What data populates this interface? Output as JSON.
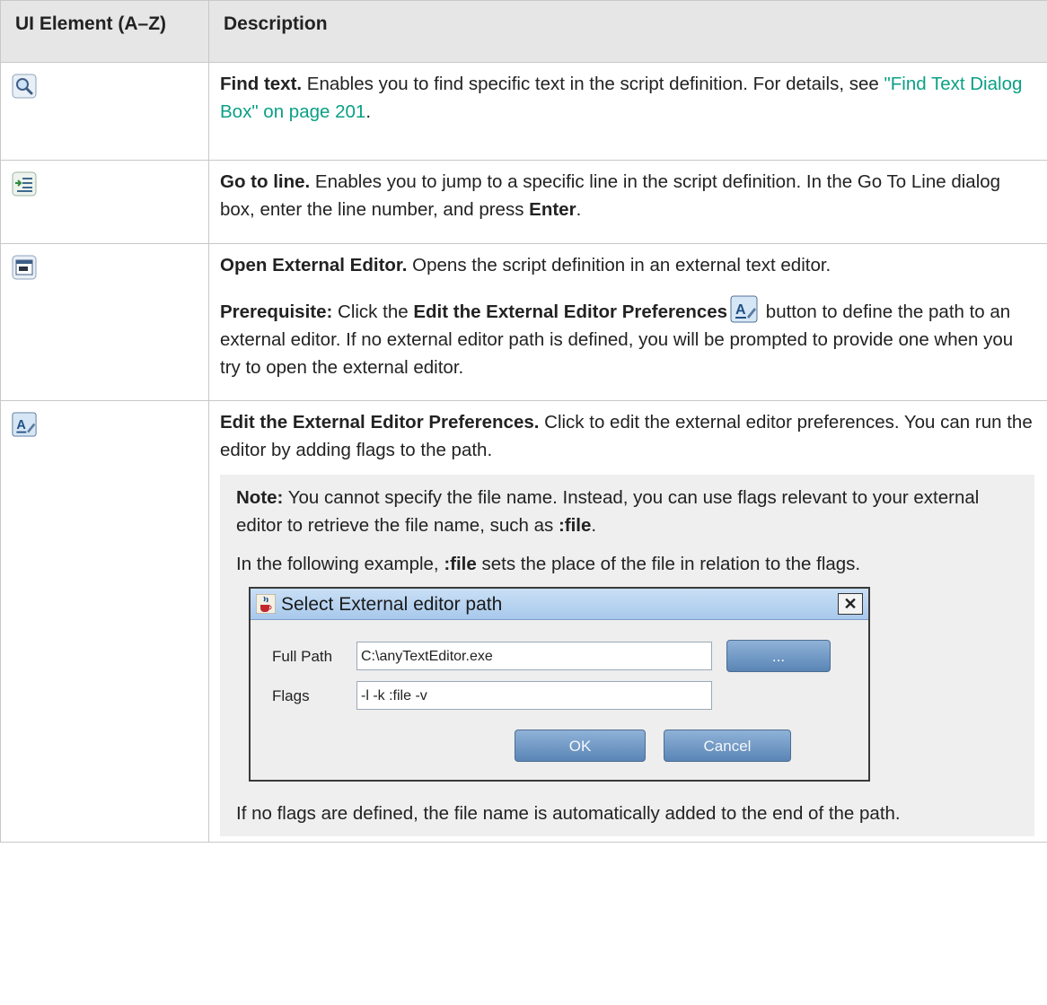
{
  "table": {
    "headers": [
      "UI Element (A–Z)",
      "Description"
    ]
  },
  "rows": {
    "find": {
      "icon": "magnifier-icon",
      "bold": "Find text.",
      "text": " Enables you to find specific text in the script definition. For details, see ",
      "link": "\"Find Text Dialog Box\" on page 201",
      "tail": "."
    },
    "goto": {
      "icon": "goto-line-icon",
      "bold": "Go to line.",
      "text": " Enables you to jump to a specific line in the script definition. In the Go To Line dialog box, enter the line number, and press ",
      "bold2": "Enter",
      "tail": "."
    },
    "open": {
      "icon": "external-editor-icon",
      "bold": "Open External Editor.",
      "text": " Opens the script definition in an external text editor.",
      "prereq_bold": "Prerequisite:",
      "prereq_text1": " Click the ",
      "prereq_bold2": "Edit the External Editor Preferences",
      "prereq_text2": " button to define the path to an external editor. If no external editor path is defined, you will be prompted to provide one when you try to open the external editor."
    },
    "edit": {
      "icon": "edit-preferences-icon",
      "bold": "Edit the External Editor Preferences.",
      "text": " Click to edit the external editor preferences. You can run the editor by adding flags to the path.",
      "note_bold": "Note:",
      "note_text": " You cannot specify the file name. Instead, you can use flags relevant to your external editor to retrieve the file name, such as ",
      "note_flag": ":file",
      "note_tail": ".",
      "example_text1": "In the following example, ",
      "example_flag": ":file",
      "example_text2": " sets the place of the file in relation to the flags.",
      "after_text": "If no flags are defined, the file name is automatically added to the end of the path."
    }
  },
  "dialog": {
    "title": "Select External editor path",
    "close": "✕",
    "full_path_label": "Full Path",
    "full_path_value": "C:\\anyTextEditor.exe",
    "browse_label": "...",
    "flags_label": "Flags",
    "flags_value": "-l -k :file -v",
    "ok_label": "OK",
    "cancel_label": "Cancel"
  },
  "colors": {
    "link": "#0aa085",
    "header_bg": "#e6e6e6",
    "note_bg": "#efefef"
  }
}
